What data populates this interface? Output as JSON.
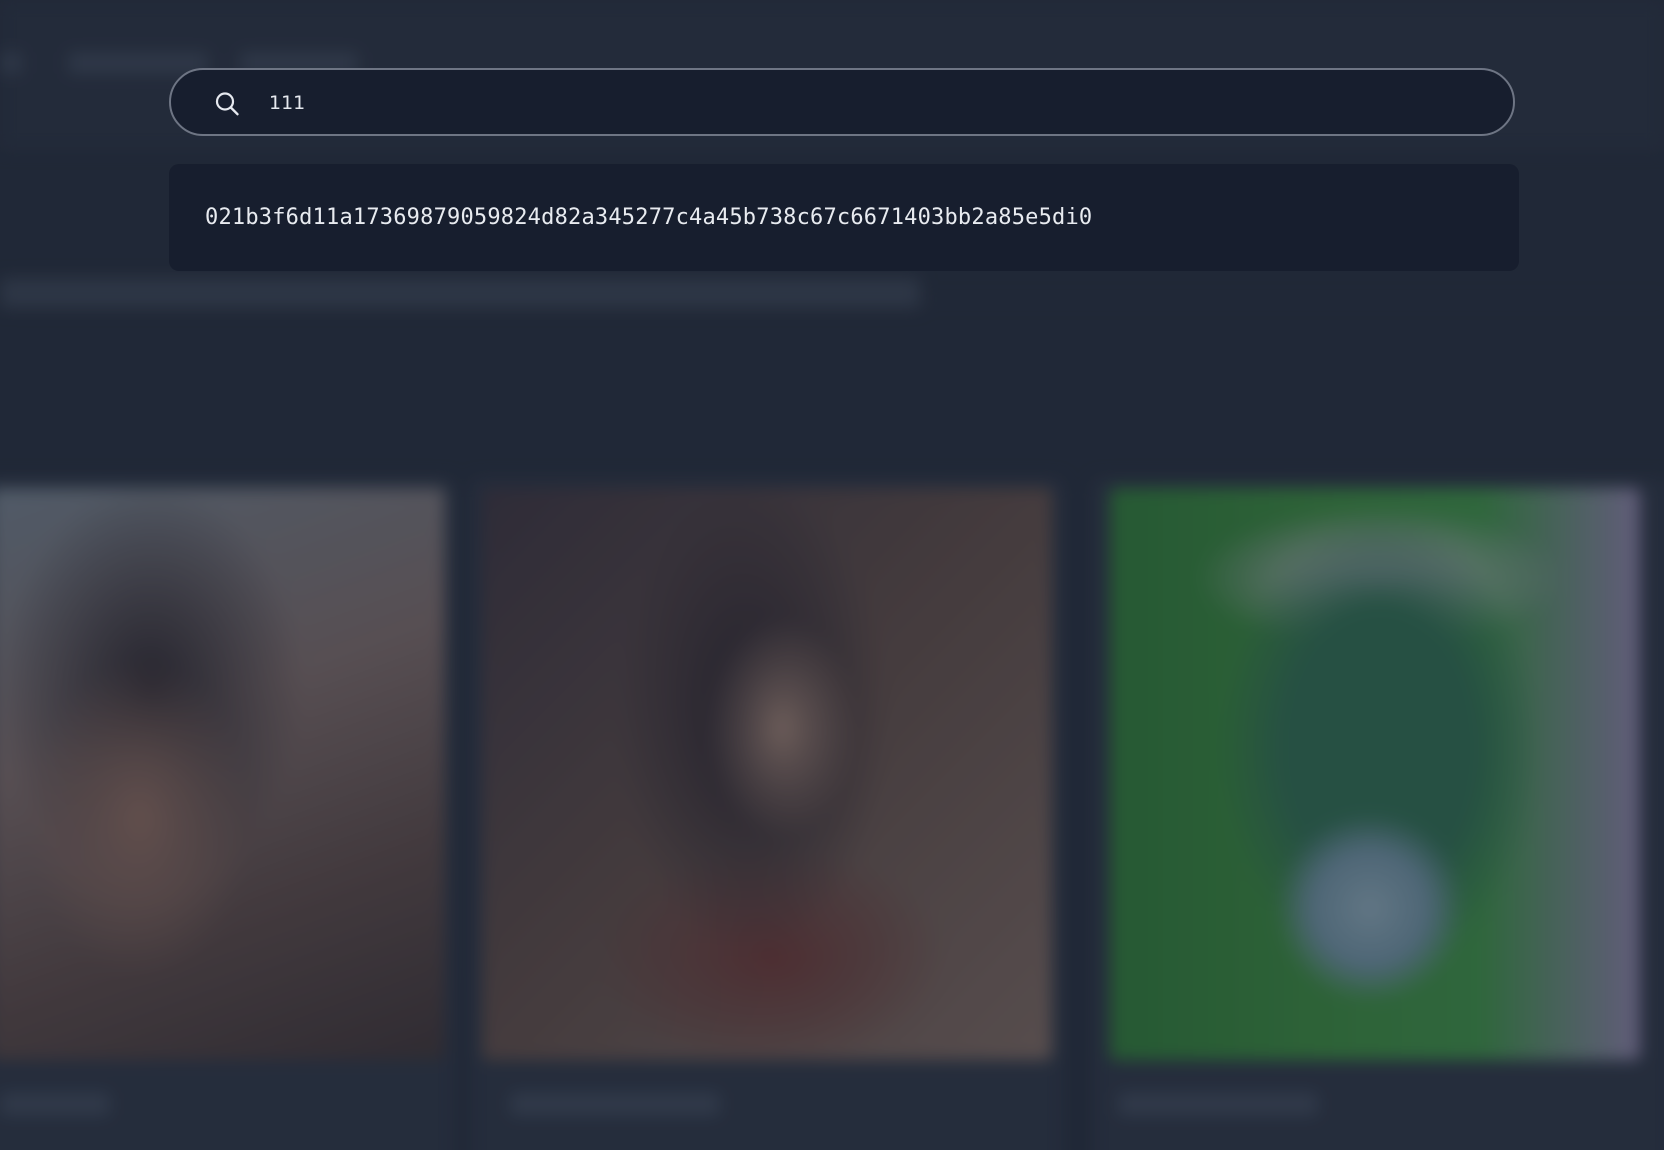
{
  "search": {
    "value": "111",
    "icon": "search-icon"
  },
  "results": [
    {
      "label": "021b3f6d11a17369879059824d82a345277c4a45b738c67c6671403bb2a85e5di0"
    }
  ],
  "colors": {
    "background": "#262f3f",
    "search_bg": "#171e2e",
    "search_border": "#6e7584",
    "text": "#e8ebf0"
  }
}
